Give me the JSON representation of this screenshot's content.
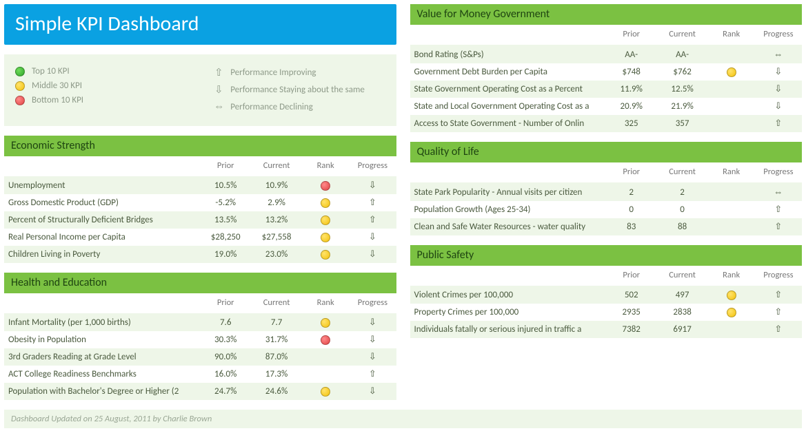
{
  "title": "Simple KPI Dashboard",
  "legend": {
    "ranks": [
      {
        "color": "green",
        "label": "Top 10 KPI"
      },
      {
        "color": "yellow",
        "label": "Middle 30 KPI"
      },
      {
        "color": "red",
        "label": "Bottom 10 KPI"
      }
    ],
    "progress": [
      {
        "glyph": "⇧",
        "label": "Performance Improving"
      },
      {
        "glyph": "⇩",
        "label": "Performance Staying about the same"
      },
      {
        "glyph": "⇔",
        "label": "Performance Declining"
      }
    ]
  },
  "columns": {
    "prior": "Prior",
    "current": "Current",
    "rank": "Rank",
    "progress": "Progress"
  },
  "panels": {
    "value_for_money": {
      "title": "Value for Money Government",
      "rows": [
        {
          "metric": "Bond Rating (S&Ps)",
          "prior": "AA-",
          "current": "AA-",
          "rank": "",
          "progress": "same"
        },
        {
          "metric": "Government Debt Burden per Capita",
          "prior": "$748",
          "current": "$762",
          "rank": "yellow",
          "progress": "down"
        },
        {
          "metric": "State Government Operating Cost as a Percent",
          "prior": "11.9%",
          "current": "12.5%",
          "rank": "",
          "progress": "down"
        },
        {
          "metric": "State and Local Government Operating Cost as a",
          "prior": "20.9%",
          "current": "21.9%",
          "rank": "",
          "progress": "down"
        },
        {
          "metric": "Access to State Government - Number of Onlin",
          "prior": "325",
          "current": "357",
          "rank": "",
          "progress": "up"
        }
      ]
    },
    "economic_strength": {
      "title": "Economic Strength",
      "rows": [
        {
          "metric": "Unemployment",
          "prior": "10.5%",
          "current": "10.9%",
          "rank": "red",
          "progress": "down"
        },
        {
          "metric": "Gross Domestic Product (GDP)",
          "prior": "-5.2%",
          "current": "2.9%",
          "rank": "yellow",
          "progress": "up"
        },
        {
          "metric": "Percent of Structurally Deficient Bridges",
          "prior": "13.5%",
          "current": "13.2%",
          "rank": "yellow",
          "progress": "up"
        },
        {
          "metric": "Real Personal Income per Capita",
          "prior": "$28,250",
          "current": "$27,558",
          "rank": "yellow",
          "progress": "down"
        },
        {
          "metric": "Children Living in Poverty",
          "prior": "19.0%",
          "current": "23.0%",
          "rank": "yellow",
          "progress": "down"
        }
      ]
    },
    "quality_of_life": {
      "title": "Quality of Life",
      "rows": [
        {
          "metric": "State Park Popularity - Annual visits per citizen",
          "prior": "2",
          "current": "2",
          "rank": "",
          "progress": "same"
        },
        {
          "metric": "Population Growth (Ages 25-34)",
          "prior": "0",
          "current": "0",
          "rank": "",
          "progress": "up"
        },
        {
          "metric": "Clean and Safe Water Resources - water quality",
          "prior": "83",
          "current": "88",
          "rank": "",
          "progress": "up"
        }
      ]
    },
    "health_education": {
      "title": "Health and Education",
      "rows": [
        {
          "metric": "Infant Mortality (per 1,000 births)",
          "prior": "7.6",
          "current": "7.7",
          "rank": "yellow",
          "progress": "down"
        },
        {
          "metric": "Obesity in Population",
          "prior": "30.3%",
          "current": "31.7%",
          "rank": "red",
          "progress": "down"
        },
        {
          "metric": "3rd Graders Reading at Grade Level",
          "prior": "90.0%",
          "current": "87.0%",
          "rank": "",
          "progress": "down"
        },
        {
          "metric": "ACT College Readiness Benchmarks",
          "prior": "16.0%",
          "current": "17.3%",
          "rank": "",
          "progress": "up"
        },
        {
          "metric": "Population with Bachelor's Degree or Higher (2",
          "prior": "24.7%",
          "current": "24.6%",
          "rank": "yellow",
          "progress": "down"
        }
      ]
    },
    "public_safety": {
      "title": "Public Safety",
      "rows": [
        {
          "metric": "Violent Crimes per 100,000",
          "prior": "502",
          "current": "497",
          "rank": "yellow",
          "progress": "up"
        },
        {
          "metric": "Property Crimes per 100,000",
          "prior": "2935",
          "current": "2838",
          "rank": "yellow",
          "progress": "up"
        },
        {
          "metric": "Individuals fatally or serious injured in traffic a",
          "prior": "7382",
          "current": "6917",
          "rank": "",
          "progress": "up"
        }
      ]
    }
  },
  "footer": "Dashboard Updated on 25 August, 2011 by Charlie Brown",
  "glyphs": {
    "up": "⇧",
    "down": "⇩",
    "same": "⇔"
  }
}
